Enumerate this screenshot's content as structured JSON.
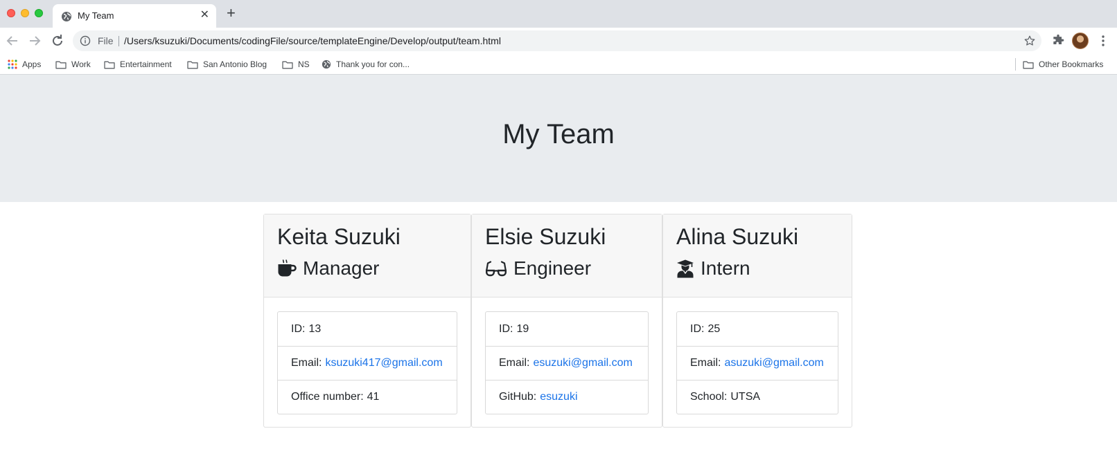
{
  "browser": {
    "tab_title": "My Team",
    "tab_close": "✕",
    "new_tab": "+",
    "scheme_label": "File",
    "url": "/Users/ksuzuki/Documents/codingFile/source/templateEngine/Develop/output/team.html",
    "bookmarks": [
      {
        "label": "Apps",
        "icon": "apps-grid-icon"
      },
      {
        "label": "Work",
        "icon": "folder-icon"
      },
      {
        "label": "Entertainment",
        "icon": "folder-icon"
      },
      {
        "label": "San Antonio Blog",
        "icon": "folder-icon"
      },
      {
        "label": "NS",
        "icon": "folder-icon"
      },
      {
        "label": "Thank you for con...",
        "icon": "globe-icon"
      }
    ],
    "other_bookmarks": "Other Bookmarks"
  },
  "page": {
    "title": "My Team"
  },
  "team": [
    {
      "name": "Keita Suzuki",
      "role": "Manager",
      "role_icon": "coffee-mug-icon",
      "id_label": "ID:",
      "id": "13",
      "email_label": "Email:",
      "email": "ksuzuki417@gmail.com",
      "extra_label": "Office number:",
      "extra": "41"
    },
    {
      "name": "Elsie Suzuki",
      "role": "Engineer",
      "role_icon": "glasses-icon",
      "id_label": "ID:",
      "id": "19",
      "email_label": "Email:",
      "email": "esuzuki@gmail.com",
      "extra_label": "GitHub:",
      "extra": "esuzuki"
    },
    {
      "name": "Alina Suzuki",
      "role": "Intern",
      "role_icon": "graduate-icon",
      "id_label": "ID:",
      "id": "25",
      "email_label": "Email:",
      "email": "asuzuki@gmail.com",
      "extra_label": "School:",
      "extra": "UTSA"
    }
  ],
  "colors": {
    "link": "#1a73e8",
    "jumbotron": "#e9ecef",
    "card_header": "#f7f7f7"
  }
}
